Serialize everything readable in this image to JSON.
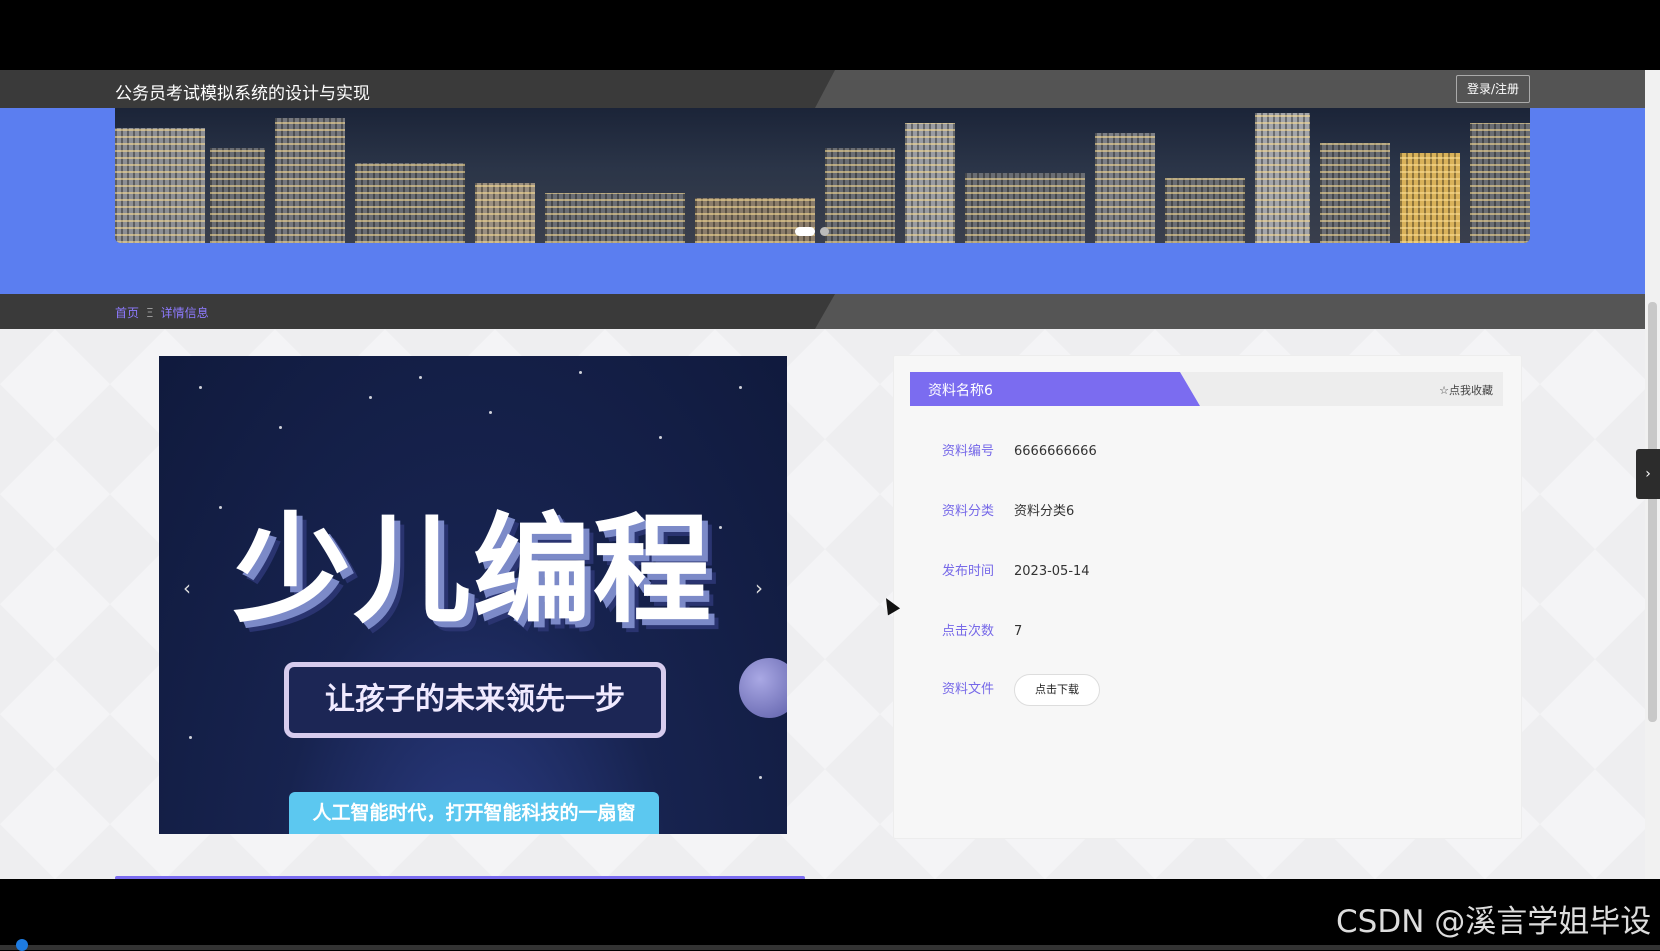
{
  "header": {
    "site_title": "公务员考试模拟系统的设计与实现",
    "login_label": "登录/注册"
  },
  "breadcrumb": {
    "home": "首页",
    "separator": "Ξ",
    "current": "详情信息"
  },
  "poster": {
    "title": "少儿编程",
    "tagline": "让孩子的未来领先一步",
    "subline": "人工智能时代，打开智能科技的一扇窗",
    "prev_arrow": "‹",
    "next_arrow": "›"
  },
  "detail": {
    "name": "资料名称6",
    "favorite_label": "☆点我收藏",
    "fields": [
      {
        "label": "资料编号",
        "value": "6666666666"
      },
      {
        "label": "资料分类",
        "value": "资料分类6"
      },
      {
        "label": "发布时间",
        "value": "2023-05-14"
      },
      {
        "label": "点击次数",
        "value": "7"
      },
      {
        "label": "资料文件",
        "value": "点击下载"
      }
    ]
  },
  "side_tab_icon": "›",
  "watermark": "CSDN @溪言学姐毕设",
  "colors": {
    "accent": "#7b6cf0",
    "banner": "#5b7ef0",
    "header": "#3a3a3a"
  }
}
